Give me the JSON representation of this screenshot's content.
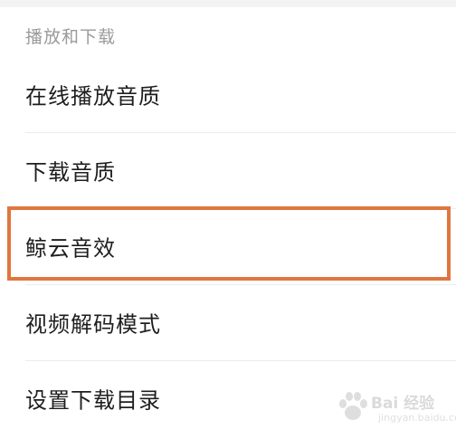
{
  "section": {
    "title": "播放和下载"
  },
  "settings": {
    "items": [
      {
        "label": "在线播放音质"
      },
      {
        "label": "下载音质"
      },
      {
        "label": "鲸云音效"
      },
      {
        "label": "视频解码模式"
      },
      {
        "label": "设置下载目录"
      }
    ]
  },
  "highlight": {
    "color": "#e0763f",
    "target": "鲸云音效"
  },
  "watermark": {
    "text": "Bai 经验",
    "subtext": "jingyan.baidu.com"
  }
}
